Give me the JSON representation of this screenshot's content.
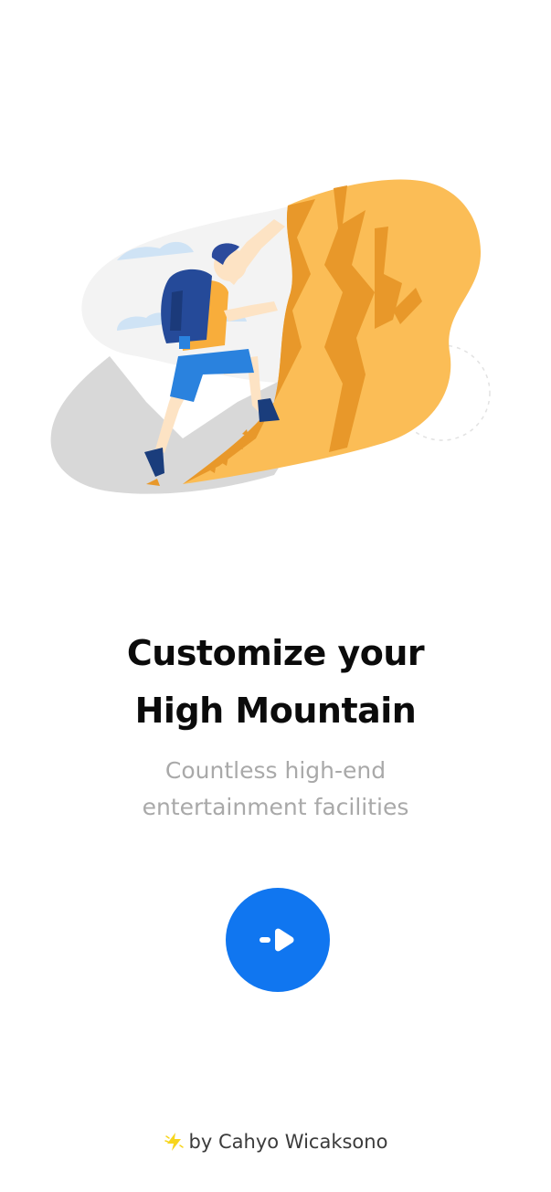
{
  "app": {
    "illustration": "mountain-climber-illustration",
    "accent_color": "#1076f0",
    "rock_color": "#fbbd56"
  },
  "onboarding": {
    "title_line1": "Customize your",
    "title_line2": "High Mountain",
    "subtitle_line1": "Countless high-end",
    "subtitle_line2": "entertainment facilities",
    "next_button_icon": "arrow-right-icon"
  },
  "footer": {
    "credit": "by Cahyo Wicaksono",
    "icon": "lightning-icon"
  }
}
